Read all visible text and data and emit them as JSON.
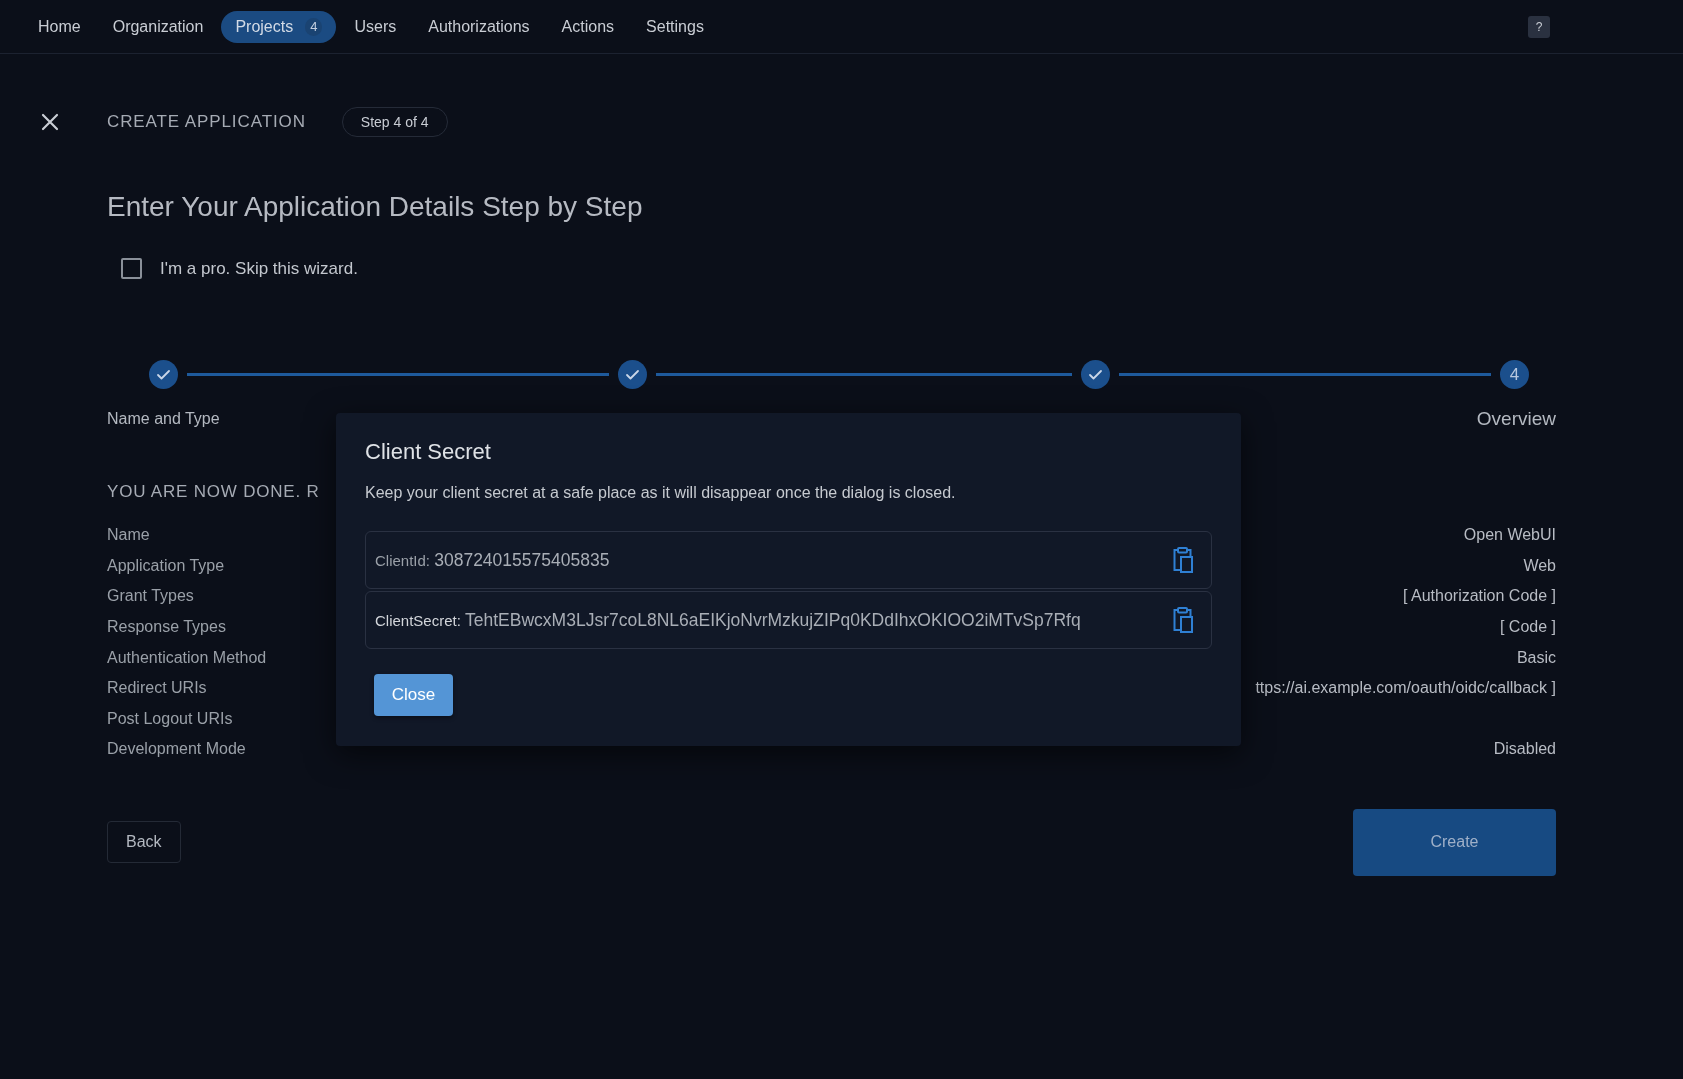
{
  "nav": {
    "items": [
      {
        "label": "Home",
        "selected": false
      },
      {
        "label": "Organization",
        "selected": false
      },
      {
        "label": "Projects",
        "selected": true,
        "badge": "4"
      },
      {
        "label": "Users",
        "selected": false
      },
      {
        "label": "Authorizations",
        "selected": false
      },
      {
        "label": "Actions",
        "selected": false
      },
      {
        "label": "Settings",
        "selected": false
      }
    ],
    "help": "?"
  },
  "wizard": {
    "title": "CREATE APPLICATION",
    "step_badge": "Step 4 of 4",
    "heading": "Enter Your Application Details Step by Step",
    "skip_checkbox": {
      "label": "I'm a pro. Skip this wizard.",
      "checked": false
    }
  },
  "stepper": [
    {
      "label": "Name and Type",
      "done": true
    },
    {
      "done": true
    },
    {
      "done": true
    },
    {
      "number": "4",
      "label": "Overview",
      "done": false
    }
  ],
  "summary": {
    "heading": "YOU ARE NOW DONE. R",
    "rows": [
      {
        "label": "Name",
        "value": "Open WebUI"
      },
      {
        "label": "Application Type",
        "value": "Web"
      },
      {
        "label": "Grant Types",
        "value": "[ Authorization Code ]"
      },
      {
        "label": "Response Types",
        "value": "[ Code ]"
      },
      {
        "label": "Authentication Method",
        "value": "Basic"
      },
      {
        "label": "Redirect URIs",
        "value": "ttps://ai.example.com/oauth/oidc/callback ]"
      },
      {
        "label": "Post Logout URIs"
      },
      {
        "label": "Development Mode",
        "value": "Disabled"
      }
    ]
  },
  "buttons": {
    "back": "Back",
    "create": "Create"
  },
  "dialog": {
    "title": "Client Secret",
    "description": "Keep your client secret at a safe place as it will disappear once the dialog is closed.",
    "fields": [
      {
        "kind": "id",
        "label": "ClientId:",
        "value": "308724015575405835"
      },
      {
        "kind": "secret",
        "label": "ClientSecret:",
        "value": "TehtEBwcxM3LJsr7coL8NL6aEIKjoNvrMzkujZIPq0KDdIhxOKIOO2iMTvSp7Rfq"
      }
    ],
    "close": "Close"
  }
}
